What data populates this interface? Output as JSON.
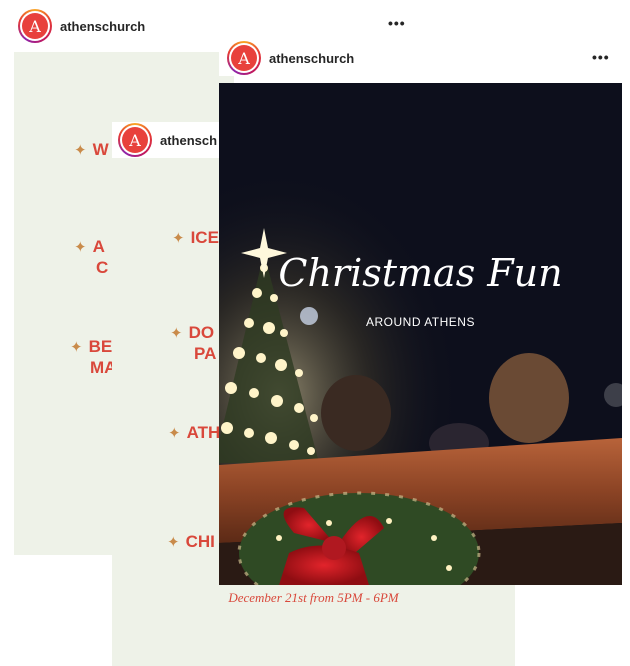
{
  "post_back": {
    "username": "athenschurch",
    "avatar_letter": "A",
    "more": "•••",
    "items": [
      "W",
      "A",
      "C",
      "BE",
      "MA"
    ]
  },
  "post_middle": {
    "username": "athensch",
    "avatar_letter": "A",
    "items": [
      "ICE",
      "DO",
      "PA",
      "ATH",
      "CHI"
    ],
    "footer_text": "December 21st from 5PM - 6PM"
  },
  "post_front": {
    "username": "athenschurch",
    "avatar_letter": "A",
    "more": "•••",
    "title": "Christmas Fun",
    "subtitle": "AROUND ATHENS"
  },
  "colors": {
    "accent_red": "#d9483b",
    "panel_bg": "#eef2e8",
    "star_gold": "#c98b4a"
  }
}
